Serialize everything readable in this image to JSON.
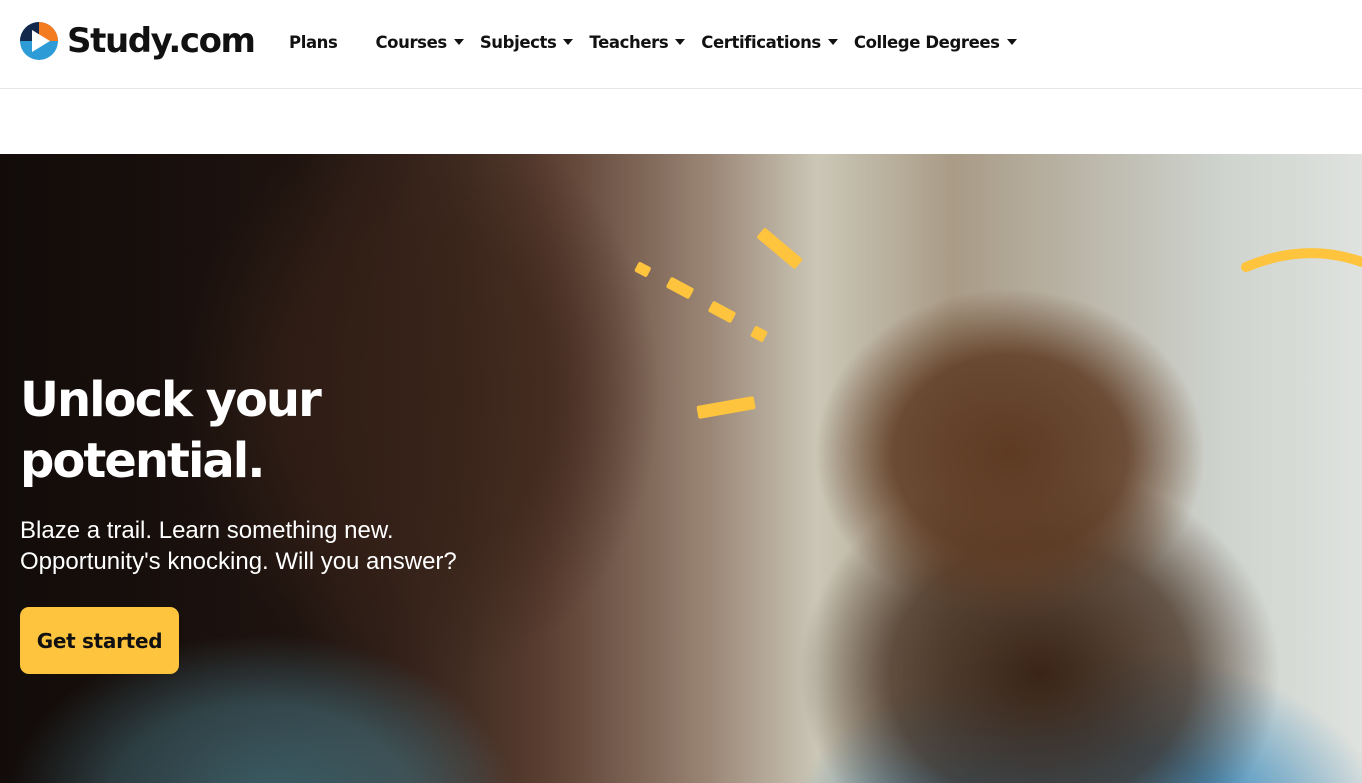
{
  "brand": {
    "name": "Study.com",
    "colors": {
      "blue": "#2c9bd6",
      "orange": "#f47b20",
      "navy": "#13294b",
      "accent_yellow": "#ffc43d"
    }
  },
  "nav": {
    "items": [
      {
        "label": "Plans",
        "has_dropdown": false
      },
      {
        "label": "Courses",
        "has_dropdown": true
      },
      {
        "label": "Subjects",
        "has_dropdown": true
      },
      {
        "label": "Teachers",
        "has_dropdown": true
      },
      {
        "label": "Certifications",
        "has_dropdown": true
      },
      {
        "label": "College Degrees",
        "has_dropdown": true
      }
    ],
    "dropdown_icon": "caret-down-icon"
  },
  "hero": {
    "headline": "Unlock your potential.",
    "subtext_lines": [
      "Blaze a trail. Learn something new.",
      "Opportunity's knocking. Will you answer?"
    ],
    "cta_label": "Get started",
    "image_description_icon": "hero-photo"
  }
}
